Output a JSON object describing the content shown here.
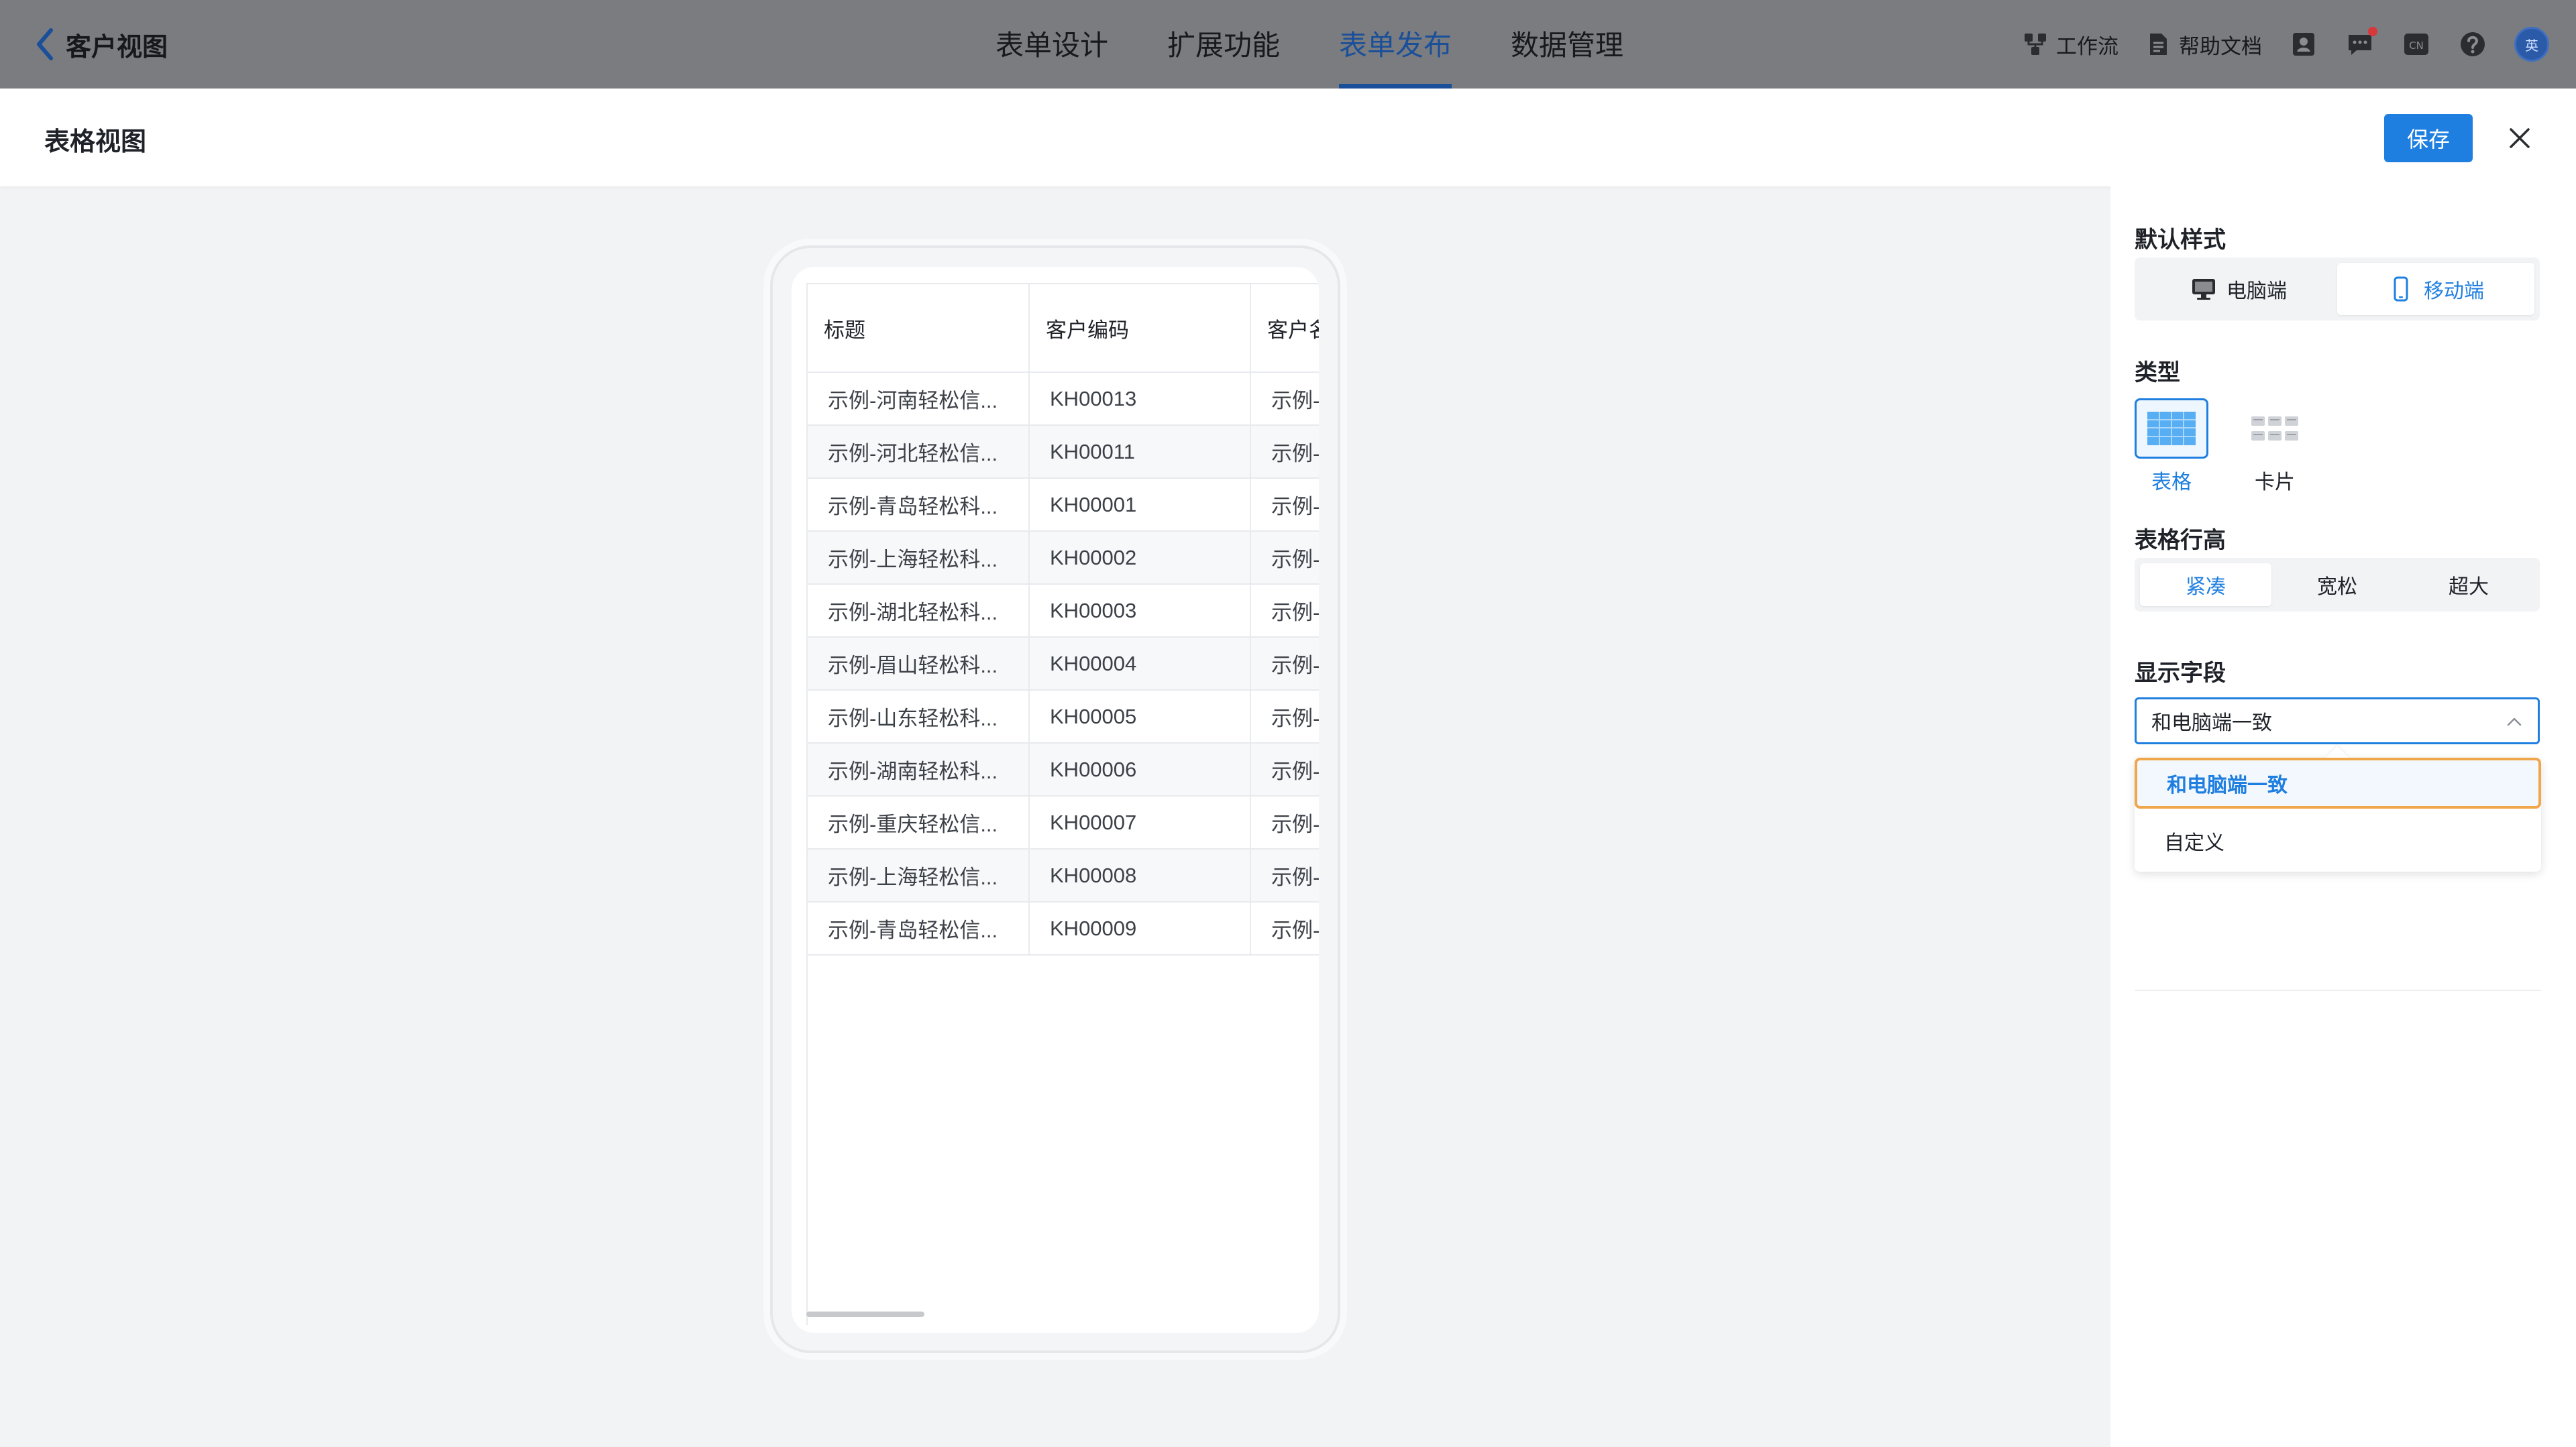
{
  "topbar": {
    "back_label": "客户视图",
    "tabs": [
      {
        "label": "表单设计"
      },
      {
        "label": "扩展功能"
      },
      {
        "label": "表单发布"
      },
      {
        "label": "数据管理"
      }
    ],
    "active_tab": "表单发布",
    "tools": {
      "workflow": "工作流",
      "help_docs": "帮助文档",
      "lang": "CN",
      "avatar_text": "英"
    }
  },
  "drawer": {
    "title": "表格视图",
    "save_label": "保存"
  },
  "preview": {
    "columns": [
      "标题",
      "客户编码",
      "客户名称"
    ],
    "rows": [
      [
        "示例-河南轻松信...",
        "KH00013",
        "示例-河南"
      ],
      [
        "示例-河北轻松信...",
        "KH00011",
        "示例-河北"
      ],
      [
        "示例-青岛轻松科...",
        "KH00001",
        "示例-青岛"
      ],
      [
        "示例-上海轻松科...",
        "KH00002",
        "示例-上海"
      ],
      [
        "示例-湖北轻松科...",
        "KH00003",
        "示例-湖北"
      ],
      [
        "示例-眉山轻松科...",
        "KH00004",
        "示例-眉山"
      ],
      [
        "示例-山东轻松科...",
        "KH00005",
        "示例-山东"
      ],
      [
        "示例-湖南轻松科...",
        "KH00006",
        "示例-湖南"
      ],
      [
        "示例-重庆轻松信...",
        "KH00007",
        "示例-重庆"
      ],
      [
        "示例-上海轻松信...",
        "KH00008",
        "示例-上海"
      ],
      [
        "示例-青岛轻松信...",
        "KH00009",
        "示例-青岛"
      ]
    ]
  },
  "panel": {
    "default_style": {
      "title": "默认样式",
      "options": [
        "电脑端",
        "移动端"
      ],
      "selected": "移动端"
    },
    "type": {
      "title": "类型",
      "options": [
        "表格",
        "卡片"
      ],
      "selected": "表格"
    },
    "row_height": {
      "title": "表格行高",
      "options": [
        "紧凑",
        "宽松",
        "超大"
      ],
      "selected": "紧凑"
    },
    "display_fields": {
      "title": "显示字段",
      "value": "和电脑端一致",
      "options": [
        "和电脑端一致",
        "自定义"
      ]
    }
  },
  "colors": {
    "accent": "#1f7fe0",
    "highlight_border": "#f0a64a",
    "overlay_bar": "#7b7c7f"
  }
}
